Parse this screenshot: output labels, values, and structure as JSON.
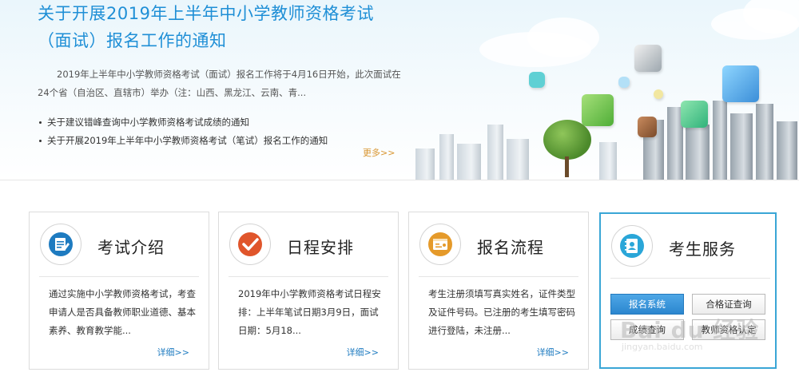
{
  "banner": {
    "title": "关于开展2019年上半年中小学教师资格考试（面试）报名工作的通知",
    "summary": "2019年上半年中小学教师资格考试（面试）报名工作将于4月16日开始，此次面试在24个省（自治区、直辖市）举办（注：山西、黑龙江、云南、青...",
    "related": [
      "关于建议错峰查询中小学教师资格考试成绩的通知",
      "关于开展2019年上半年中小学教师资格考试（笔试）报名工作的通知"
    ],
    "more_label": "更多>>"
  },
  "cards": [
    {
      "title": "考试介绍",
      "icon": "exam-intro-icon",
      "icon_color": "#1e7bc0",
      "desc": "通过实施中小学教师资格考试，考查申请人是否具备教师职业道德、基本素养、教育教学能...",
      "link": "详细>>"
    },
    {
      "title": "日程安排",
      "icon": "checkmark-icon",
      "icon_color": "#e0552b",
      "desc": "2019年中小学教师资格考试日程安排：上半年笔试日期3月9日，面试日期：5月18...",
      "link": "详细>>"
    },
    {
      "title": "报名流程",
      "icon": "registration-form-icon",
      "icon_color": "#e59a2a",
      "desc": "考生注册须填写真实姓名，证件类型及证件号码。已注册的考生填写密码进行登陆，未注册...",
      "link": "详细>>"
    }
  ],
  "service": {
    "title": "考生服务",
    "icon": "address-book-icon",
    "icon_color": "#2aa6d8",
    "buttons": [
      "报名系统",
      "合格证查询",
      "成绩查询",
      "教师资格认定"
    ]
  },
  "watermark": {
    "main": "Bai du 经验",
    "sub": "jingyan.baidu.com"
  },
  "colors": {
    "title_blue": "#1f8fd6",
    "more_orange": "#d8952e",
    "link_blue": "#1e7bc0",
    "service_border": "#3aa6d6"
  }
}
